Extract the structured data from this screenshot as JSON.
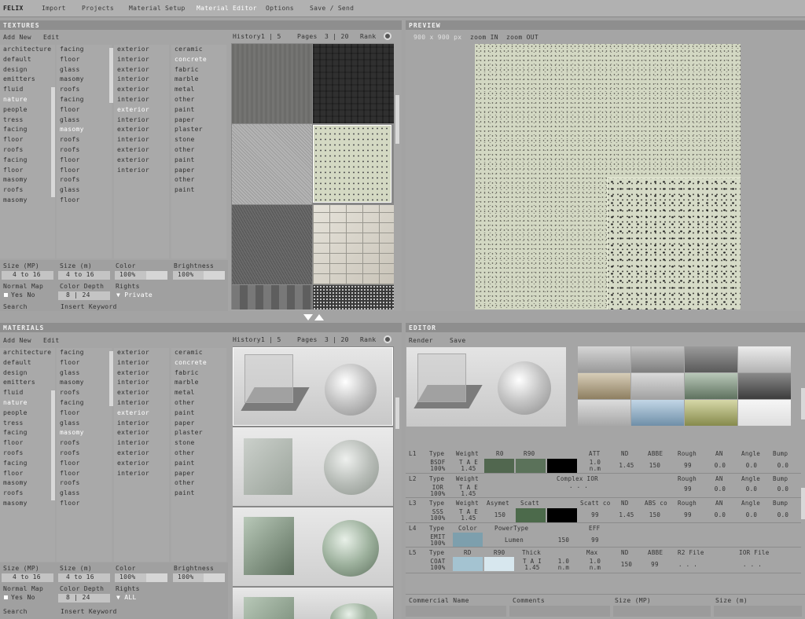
{
  "menu": {
    "brand": "FELIX",
    "items": [
      "Import",
      "Projects",
      "Material Setup",
      "Material Editor",
      "Options",
      "Save / Send"
    ]
  },
  "textures": {
    "title": "TEXTURES",
    "add": "Add New",
    "edit": "Edit",
    "history": "History",
    "history_pages": "1 | 5",
    "pages": "Pages",
    "pages_val": "3 | 20",
    "rank": "Rank",
    "col1": [
      "architecture",
      "default",
      "design",
      "emitters",
      "fluid",
      "nature",
      "people",
      "tress",
      "facing",
      "floor",
      "roofs",
      "facing",
      "floor",
      "masomy",
      "roofs",
      "masomy"
    ],
    "col2": [
      "facing",
      "floor",
      "glass",
      "masomy",
      "roofs",
      "facing",
      "floor",
      "glass",
      "masomy",
      "roofs",
      "roofs",
      "floor",
      "floor",
      "roofs",
      "glass",
      "floor"
    ],
    "col3": [
      "exterior",
      "interior",
      "exterior",
      "interior",
      "exterior",
      "interior",
      "exterior",
      "interior",
      "exterior",
      "interior",
      "exterior",
      "exterior",
      "interior"
    ],
    "col4": [
      "ceramic",
      "concrete",
      "fabric",
      "marble",
      "metal",
      "other",
      "paint",
      "paper",
      "plaster",
      "stone",
      "other",
      "paint",
      "paper",
      "other",
      "paint"
    ],
    "hl1": "nature",
    "hl3": "exterior",
    "hl4": "concrete",
    "hl2": "masomy",
    "filters": {
      "size_mp": "Size (MP)",
      "size_m": "Size (m)",
      "color": "Color",
      "brightness": "Brightness",
      "size_mp_val": "4 to 16",
      "size_m_val": "4 to 16",
      "color_val": "100%",
      "brightness_val": "100%",
      "normal_map": "Normal Map",
      "color_depth": "Color Depth",
      "rights": "Rights",
      "normal_val": "Yes  No",
      "depth_val": "8 | 24",
      "rights_val": "Private",
      "search": "Search",
      "keyword": "Insert Keyword"
    }
  },
  "preview": {
    "title": "PREVIEW",
    "size": "900 x 900 px",
    "zoom_in": "zoom IN",
    "zoom_out": "zoom OUT"
  },
  "materials": {
    "title": "MATERIALS",
    "add": "Add New",
    "edit": "Edit",
    "history": "History",
    "history_pages": "1 | 5",
    "pages": "Pages",
    "pages_val": "3 | 20",
    "rank": "Rank",
    "col1": [
      "architecture",
      "default",
      "design",
      "emitters",
      "fluid",
      "nature",
      "people",
      "tress",
      "facing",
      "floor",
      "roofs",
      "facing",
      "floor",
      "masomy",
      "roofs",
      "masomy"
    ],
    "col2": [
      "facing",
      "floor",
      "glass",
      "masomy",
      "roofs",
      "facing",
      "floor",
      "glass",
      "masomy",
      "roofs",
      "roofs",
      "floor",
      "floor",
      "roofs",
      "glass",
      "floor"
    ],
    "col3": [
      "exterior",
      "interior",
      "exterior",
      "interior",
      "exterior",
      "interior",
      "exterior",
      "interior",
      "exterior",
      "interior",
      "exterior",
      "exterior",
      "interior"
    ],
    "col4": [
      "ceramic",
      "concrete",
      "fabric",
      "marble",
      "metal",
      "other",
      "paint",
      "paper",
      "plaster",
      "stone",
      "other",
      "paint",
      "paper",
      "other",
      "paint"
    ],
    "hl1": "nature",
    "hl3": "exterior",
    "hl4": "concrete",
    "hl2": "masomy",
    "filters": {
      "size_mp": "Size (MP)",
      "size_m": "Size (m)",
      "color": "Color",
      "brightness": "Brightness",
      "size_mp_val": "4 to 16",
      "size_m_val": "4 to 16",
      "color_val": "100%",
      "brightness_val": "100%",
      "normal_map": "Normal Map",
      "color_depth": "Color Depth",
      "rights": "Rights",
      "normal_val": "Yes  No",
      "depth_val": "8 | 24",
      "rights_val": "ALL",
      "search": "Search",
      "keyword": "Insert Keyword"
    }
  },
  "editor": {
    "title": "EDITOR",
    "render": "Render",
    "save": "Save",
    "layers": [
      {
        "id": "L1",
        "h": [
          "Type",
          "Weight",
          "R0",
          "R90",
          "ATT",
          "ND",
          "ABBE",
          "Rough",
          "AN",
          "Angle",
          "Bump"
        ],
        "v": {
          "type": "BSDF\n100%",
          "weight": "T A E\n1.45",
          "att": "1.0\nn.m",
          "nd": "1.45",
          "abbe": "150",
          "rough": "99",
          "an": "0.0",
          "angle": "0.0",
          "bump": "0.0"
        }
      },
      {
        "id": "L2",
        "h": [
          "Type",
          "Weight",
          "Complex IOR",
          "Rough",
          "AN",
          "Angle",
          "Bump"
        ],
        "v": {
          "type": "IOR\n100%",
          "weight": "T A E\n1.45",
          "cior": ". . .",
          "rough": "99",
          "an": "0.0",
          "angle": "0.0",
          "bump": "0.0"
        }
      },
      {
        "id": "L3",
        "h": [
          "Type",
          "Weight",
          "Asymet",
          "Scatt",
          "Scatt co",
          "ND",
          "ABS co",
          "Rough",
          "AN",
          "Angle",
          "Bump"
        ],
        "v": {
          "type": "SSS\n100%",
          "weight": "T A E\n1.45",
          "asym": "150",
          "scattco": "99",
          "nd": "1.45",
          "absco": "150",
          "rough": "99",
          "an": "0.0",
          "angle": "0.0",
          "bump": "0.0"
        }
      },
      {
        "id": "L4",
        "h": [
          "Type",
          "Color",
          "PowerType",
          "EFF"
        ],
        "v": {
          "type": "EMIT\n100%",
          "power": "Lumen",
          "pv": "150",
          "eff": "99"
        }
      },
      {
        "id": "L5",
        "h": [
          "Type",
          "RD",
          "R90",
          "Thick",
          "Max",
          "ND",
          "ABBE",
          "R2 File",
          "IOR File"
        ],
        "v": {
          "type": "COAT\n100%",
          "thick": "T A I\n1.45",
          "tv": "1.0\nn.m",
          "max": "1.0\nn.m",
          "nd": "150",
          "abbe": "99",
          "r2": ". . .",
          "ior": ". . ."
        }
      }
    ],
    "footer": [
      "Commercial Name",
      "Comments",
      "Size (MP)",
      "Size (m)"
    ]
  },
  "colors": {
    "r0": "#51674f",
    "r90": "#5b725a",
    "att": "#000000",
    "scatt": "#4c6a4b",
    "scatt2": "#000000",
    "emit": "#7d9fad",
    "rd": "#a4c3d1",
    "r90b": "#d7e7ee"
  }
}
